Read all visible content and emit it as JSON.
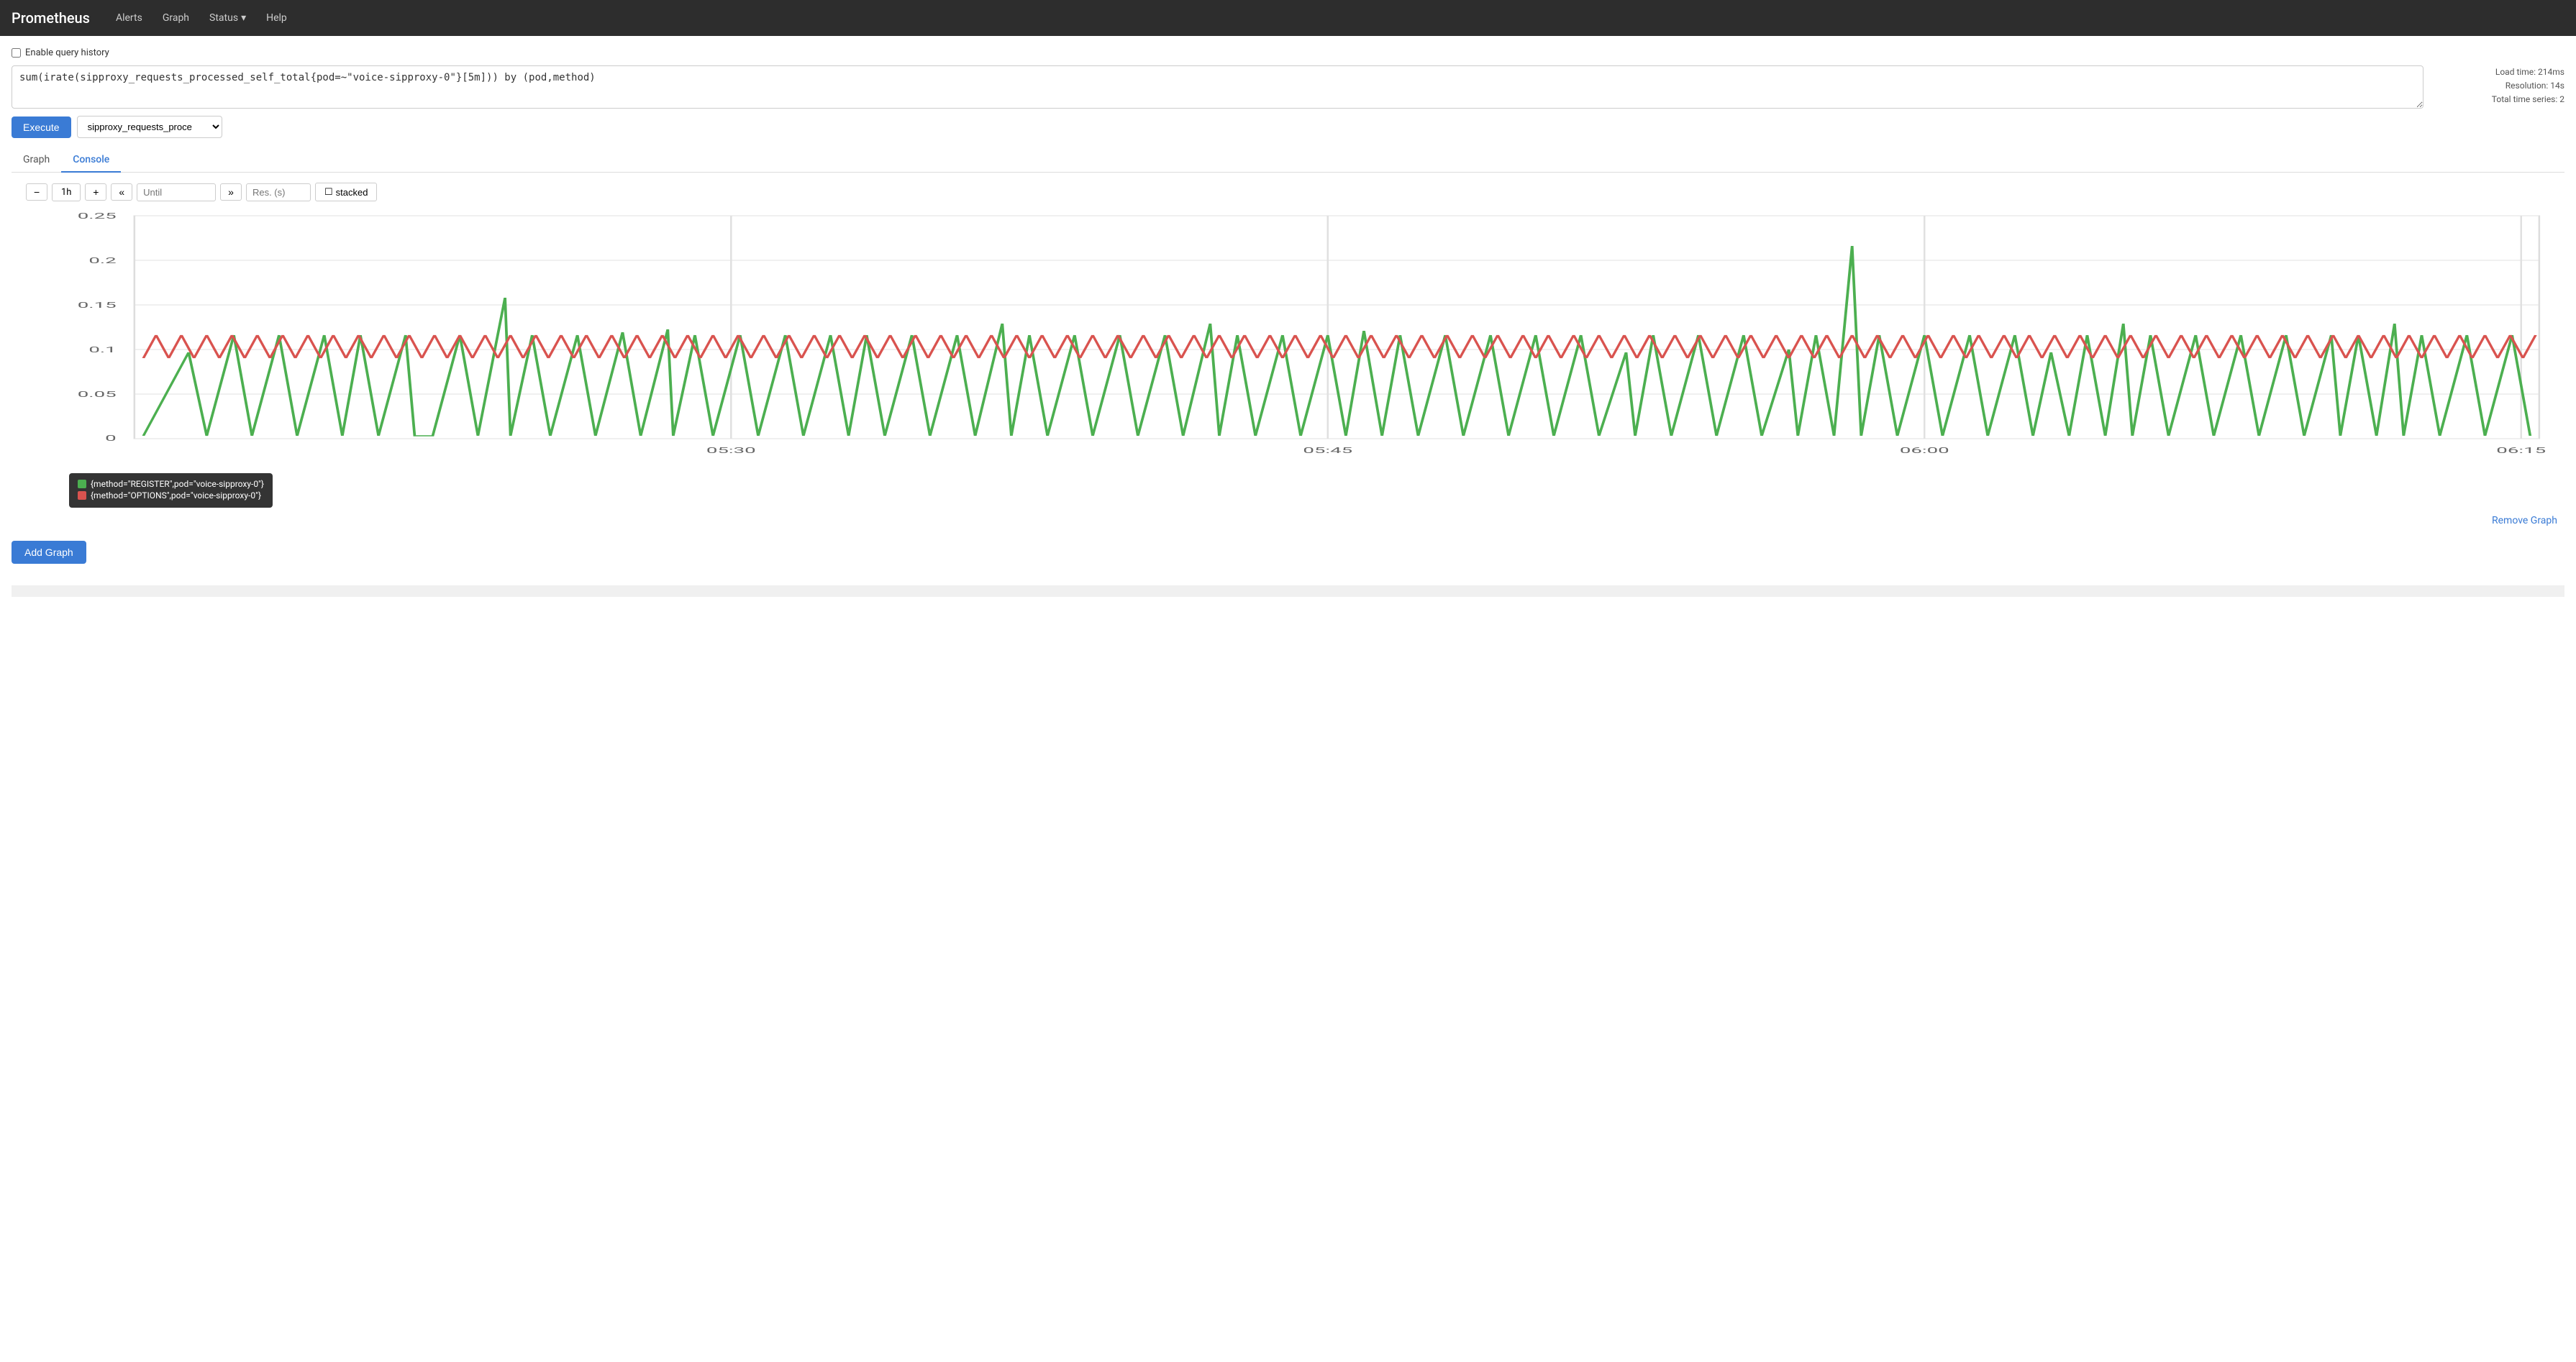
{
  "navbar": {
    "brand": "Prometheus",
    "links": [
      {
        "label": "Alerts",
        "id": "alerts"
      },
      {
        "label": "Graph",
        "id": "graph"
      },
      {
        "label": "Status",
        "id": "status",
        "dropdown": true
      },
      {
        "label": "Help",
        "id": "help"
      }
    ]
  },
  "query_section": {
    "enable_history_label": "Enable query history",
    "query_value": "sum(irate(sipproxy_requests_processed_self_total{pod=~\"voice-sipproxy-0\"}[5m])) by (pod,method)",
    "meta": {
      "load_time": "Load time: 214ms",
      "resolution": "Resolution: 14s",
      "total_series": "Total time series: 2"
    },
    "execute_label": "Execute",
    "metric_select_value": "sipproxy_requests_proce",
    "metric_options": [
      "sipproxy_requests_proce"
    ]
  },
  "tabs": [
    {
      "label": "Graph",
      "active": false
    },
    {
      "label": "Console",
      "active": true
    }
  ],
  "graph_controls": {
    "minus_label": "−",
    "time_range": "1h",
    "plus_label": "+",
    "back_label": "«",
    "until_placeholder": "Until",
    "forward_label": "»",
    "res_placeholder": "Res. (s)",
    "stacked_label": "stacked"
  },
  "graph": {
    "y_labels": [
      "0.25",
      "0.2",
      "0.15",
      "0.1",
      "0.05",
      "0"
    ],
    "x_labels": [
      "05:30",
      "05:45",
      "06:00",
      "06:15"
    ],
    "series": [
      {
        "color": "#4caf50",
        "label": "{method=\"REGISTER\",pod=\"voice-sipproxy-0\"}"
      },
      {
        "color": "#d9534f",
        "label": "{method=\"OPTIONS\",pod=\"voice-sipproxy-0\"}"
      }
    ]
  },
  "legend": {
    "items": [
      {
        "color": "#4caf50",
        "text": "{method=\"REGISTER\",pod=\"voice-sipproxy-0\"}"
      },
      {
        "color": "#d9534f",
        "text": "{method=\"OPTIONS\",pod=\"voice-sipproxy-0\"}"
      }
    ]
  },
  "remove_graph_label": "Remove Graph",
  "add_graph_label": "Add Graph"
}
